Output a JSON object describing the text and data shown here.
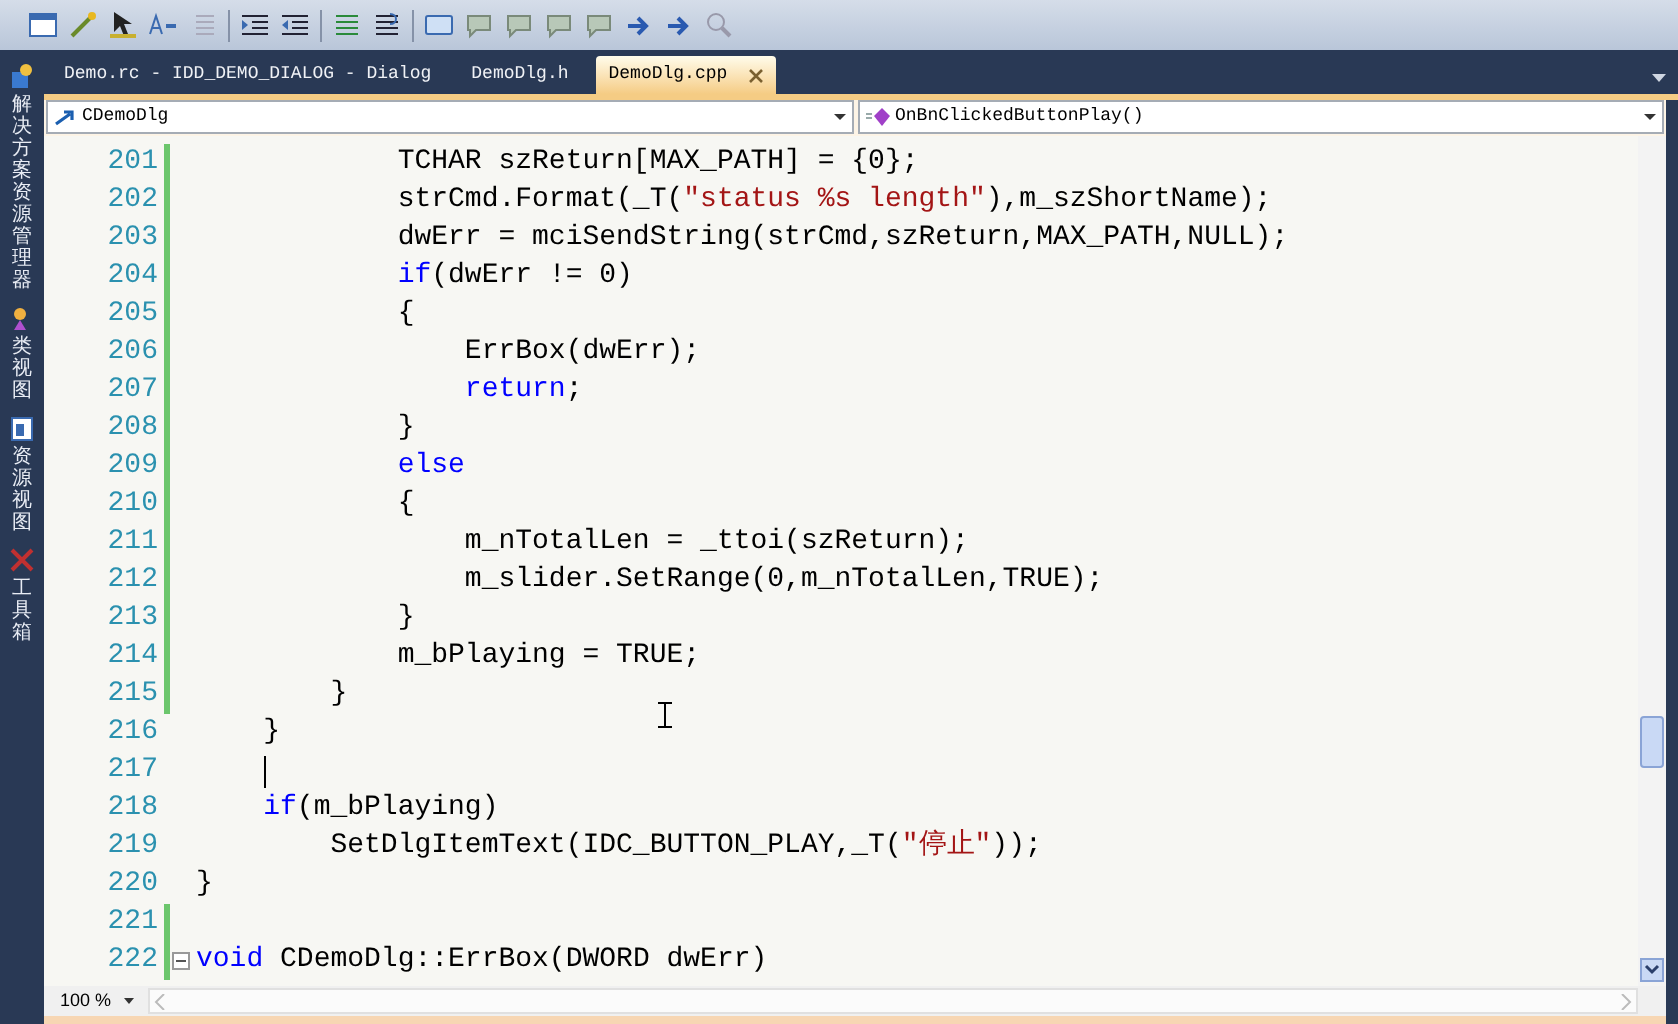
{
  "sidebar": [
    {
      "label": "解决方案资源管理器",
      "kind": "solution"
    },
    {
      "label": "类视图",
      "kind": "class"
    },
    {
      "label": "资源视图",
      "kind": "resource"
    },
    {
      "label": "工具箱",
      "kind": "toolbox"
    }
  ],
  "tabs": [
    {
      "label": "Demo.rc - IDD_DEMO_DIALOG - Dialog",
      "selected": false
    },
    {
      "label": "DemoDlg.h",
      "selected": false
    },
    {
      "label": "DemoDlg.cpp",
      "selected": true
    }
  ],
  "nav": {
    "class": "CDemoDlg",
    "member": "OnBnClickedButtonPlay()"
  },
  "lines": [
    {
      "number": "201",
      "changed": true,
      "caret": false,
      "foldable": false,
      "tokens": [
        {
          "kind": "plain",
          "text": "            TCHAR szReturn[MAX_PATH] = {0};"
        }
      ]
    },
    {
      "number": "202",
      "changed": true,
      "caret": false,
      "foldable": false,
      "tokens": [
        {
          "kind": "plain",
          "text": "            strCmd.Format(_T("
        },
        {
          "kind": "string",
          "text": "\"status %s length\""
        },
        {
          "kind": "plain",
          "text": "),m_szShortName);"
        }
      ]
    },
    {
      "number": "203",
      "changed": true,
      "caret": false,
      "foldable": false,
      "tokens": [
        {
          "kind": "plain",
          "text": "            dwErr = mciSendString(strCmd,szReturn,MAX_PATH,NULL);"
        }
      ]
    },
    {
      "number": "204",
      "changed": true,
      "caret": false,
      "foldable": false,
      "tokens": [
        {
          "kind": "keyword",
          "text": "            if"
        },
        {
          "kind": "plain",
          "text": "(dwErr != 0)"
        }
      ]
    },
    {
      "number": "205",
      "changed": true,
      "caret": false,
      "foldable": false,
      "tokens": [
        {
          "kind": "plain",
          "text": "            {"
        }
      ]
    },
    {
      "number": "206",
      "changed": true,
      "caret": false,
      "foldable": false,
      "tokens": [
        {
          "kind": "plain",
          "text": "                ErrBox(dwErr);"
        }
      ]
    },
    {
      "number": "207",
      "changed": true,
      "caret": false,
      "foldable": false,
      "tokens": [
        {
          "kind": "keyword",
          "text": "                return"
        },
        {
          "kind": "plain",
          "text": ";"
        }
      ]
    },
    {
      "number": "208",
      "changed": true,
      "caret": false,
      "foldable": false,
      "tokens": [
        {
          "kind": "plain",
          "text": "            }"
        }
      ]
    },
    {
      "number": "209",
      "changed": true,
      "caret": false,
      "foldable": false,
      "tokens": [
        {
          "kind": "keyword",
          "text": "            else"
        }
      ]
    },
    {
      "number": "210",
      "changed": true,
      "caret": false,
      "foldable": false,
      "tokens": [
        {
          "kind": "plain",
          "text": "            {"
        }
      ]
    },
    {
      "number": "211",
      "changed": true,
      "caret": false,
      "foldable": false,
      "tokens": [
        {
          "kind": "plain",
          "text": "                m_nTotalLen = _ttoi(szReturn);"
        }
      ]
    },
    {
      "number": "212",
      "changed": true,
      "caret": false,
      "foldable": false,
      "tokens": [
        {
          "kind": "plain",
          "text": "                m_slider.SetRange(0,m_nTotalLen,TRUE);"
        }
      ]
    },
    {
      "number": "213",
      "changed": true,
      "caret": false,
      "foldable": false,
      "tokens": [
        {
          "kind": "plain",
          "text": "            }"
        }
      ]
    },
    {
      "number": "214",
      "changed": true,
      "caret": false,
      "foldable": false,
      "tokens": [
        {
          "kind": "plain",
          "text": "            m_bPlaying = TRUE;"
        }
      ]
    },
    {
      "number": "215",
      "changed": true,
      "caret": false,
      "foldable": false,
      "tokens": [
        {
          "kind": "plain",
          "text": "        }"
        }
      ]
    },
    {
      "number": "216",
      "changed": false,
      "caret": false,
      "foldable": false,
      "tokens": [
        {
          "kind": "plain",
          "text": "    }"
        }
      ]
    },
    {
      "number": "217",
      "changed": false,
      "caret": true,
      "foldable": false
    },
    {
      "number": "218",
      "changed": false,
      "caret": false,
      "foldable": false,
      "tokens": [
        {
          "kind": "keyword",
          "text": "    if"
        },
        {
          "kind": "plain",
          "text": "(m_bPlaying)"
        }
      ]
    },
    {
      "number": "219",
      "changed": false,
      "caret": false,
      "foldable": false,
      "tokens": [
        {
          "kind": "plain",
          "text": "        SetDlgItemText(IDC_BUTTON_PLAY,_T("
        },
        {
          "kind": "string",
          "text": "\"停止\""
        },
        {
          "kind": "plain",
          "text": "));"
        }
      ]
    },
    {
      "number": "220",
      "changed": false,
      "caret": false,
      "foldable": false,
      "tokens": [
        {
          "kind": "plain",
          "text": "}"
        }
      ]
    },
    {
      "number": "221",
      "changed": true,
      "caret": false,
      "foldable": false
    },
    {
      "number": "222",
      "changed": true,
      "caret": false,
      "foldable": true,
      "tokens": [
        {
          "kind": "keyword",
          "text": "void"
        },
        {
          "kind": "plain",
          "text": " CDemoDlg::ErrBox(DWORD dwErr)"
        }
      ]
    }
  ],
  "zoom": "100 %"
}
